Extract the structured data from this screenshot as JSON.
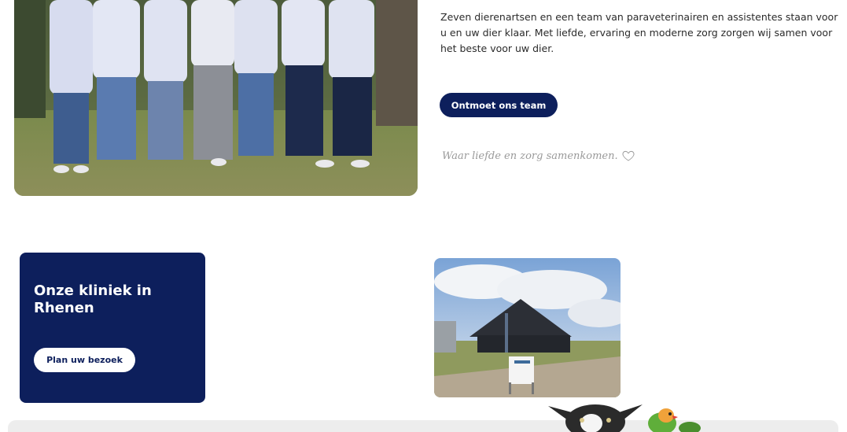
{
  "team_section": {
    "intro": "Zeven dierenartsen en een team van paraveterinairen en assistentes staan voor u en uw dier klaar. Met liefde, ervaring en moderne zorg zorgen wij samen voor het beste voor uw dier.",
    "button_label": "Ontmoet ons team",
    "tagline": "Waar liefde en zorg samenkomen."
  },
  "clinic_section": {
    "title": "Onze kliniek in Rhenen",
    "button_label": "Plan uw bezoek"
  },
  "colors": {
    "brand_navy": "#0d1f5c",
    "footer_gray": "#ededed",
    "tagline_gray": "#9a9a9a"
  },
  "icons": {
    "tagline_icon": "heart-outline-icon"
  }
}
